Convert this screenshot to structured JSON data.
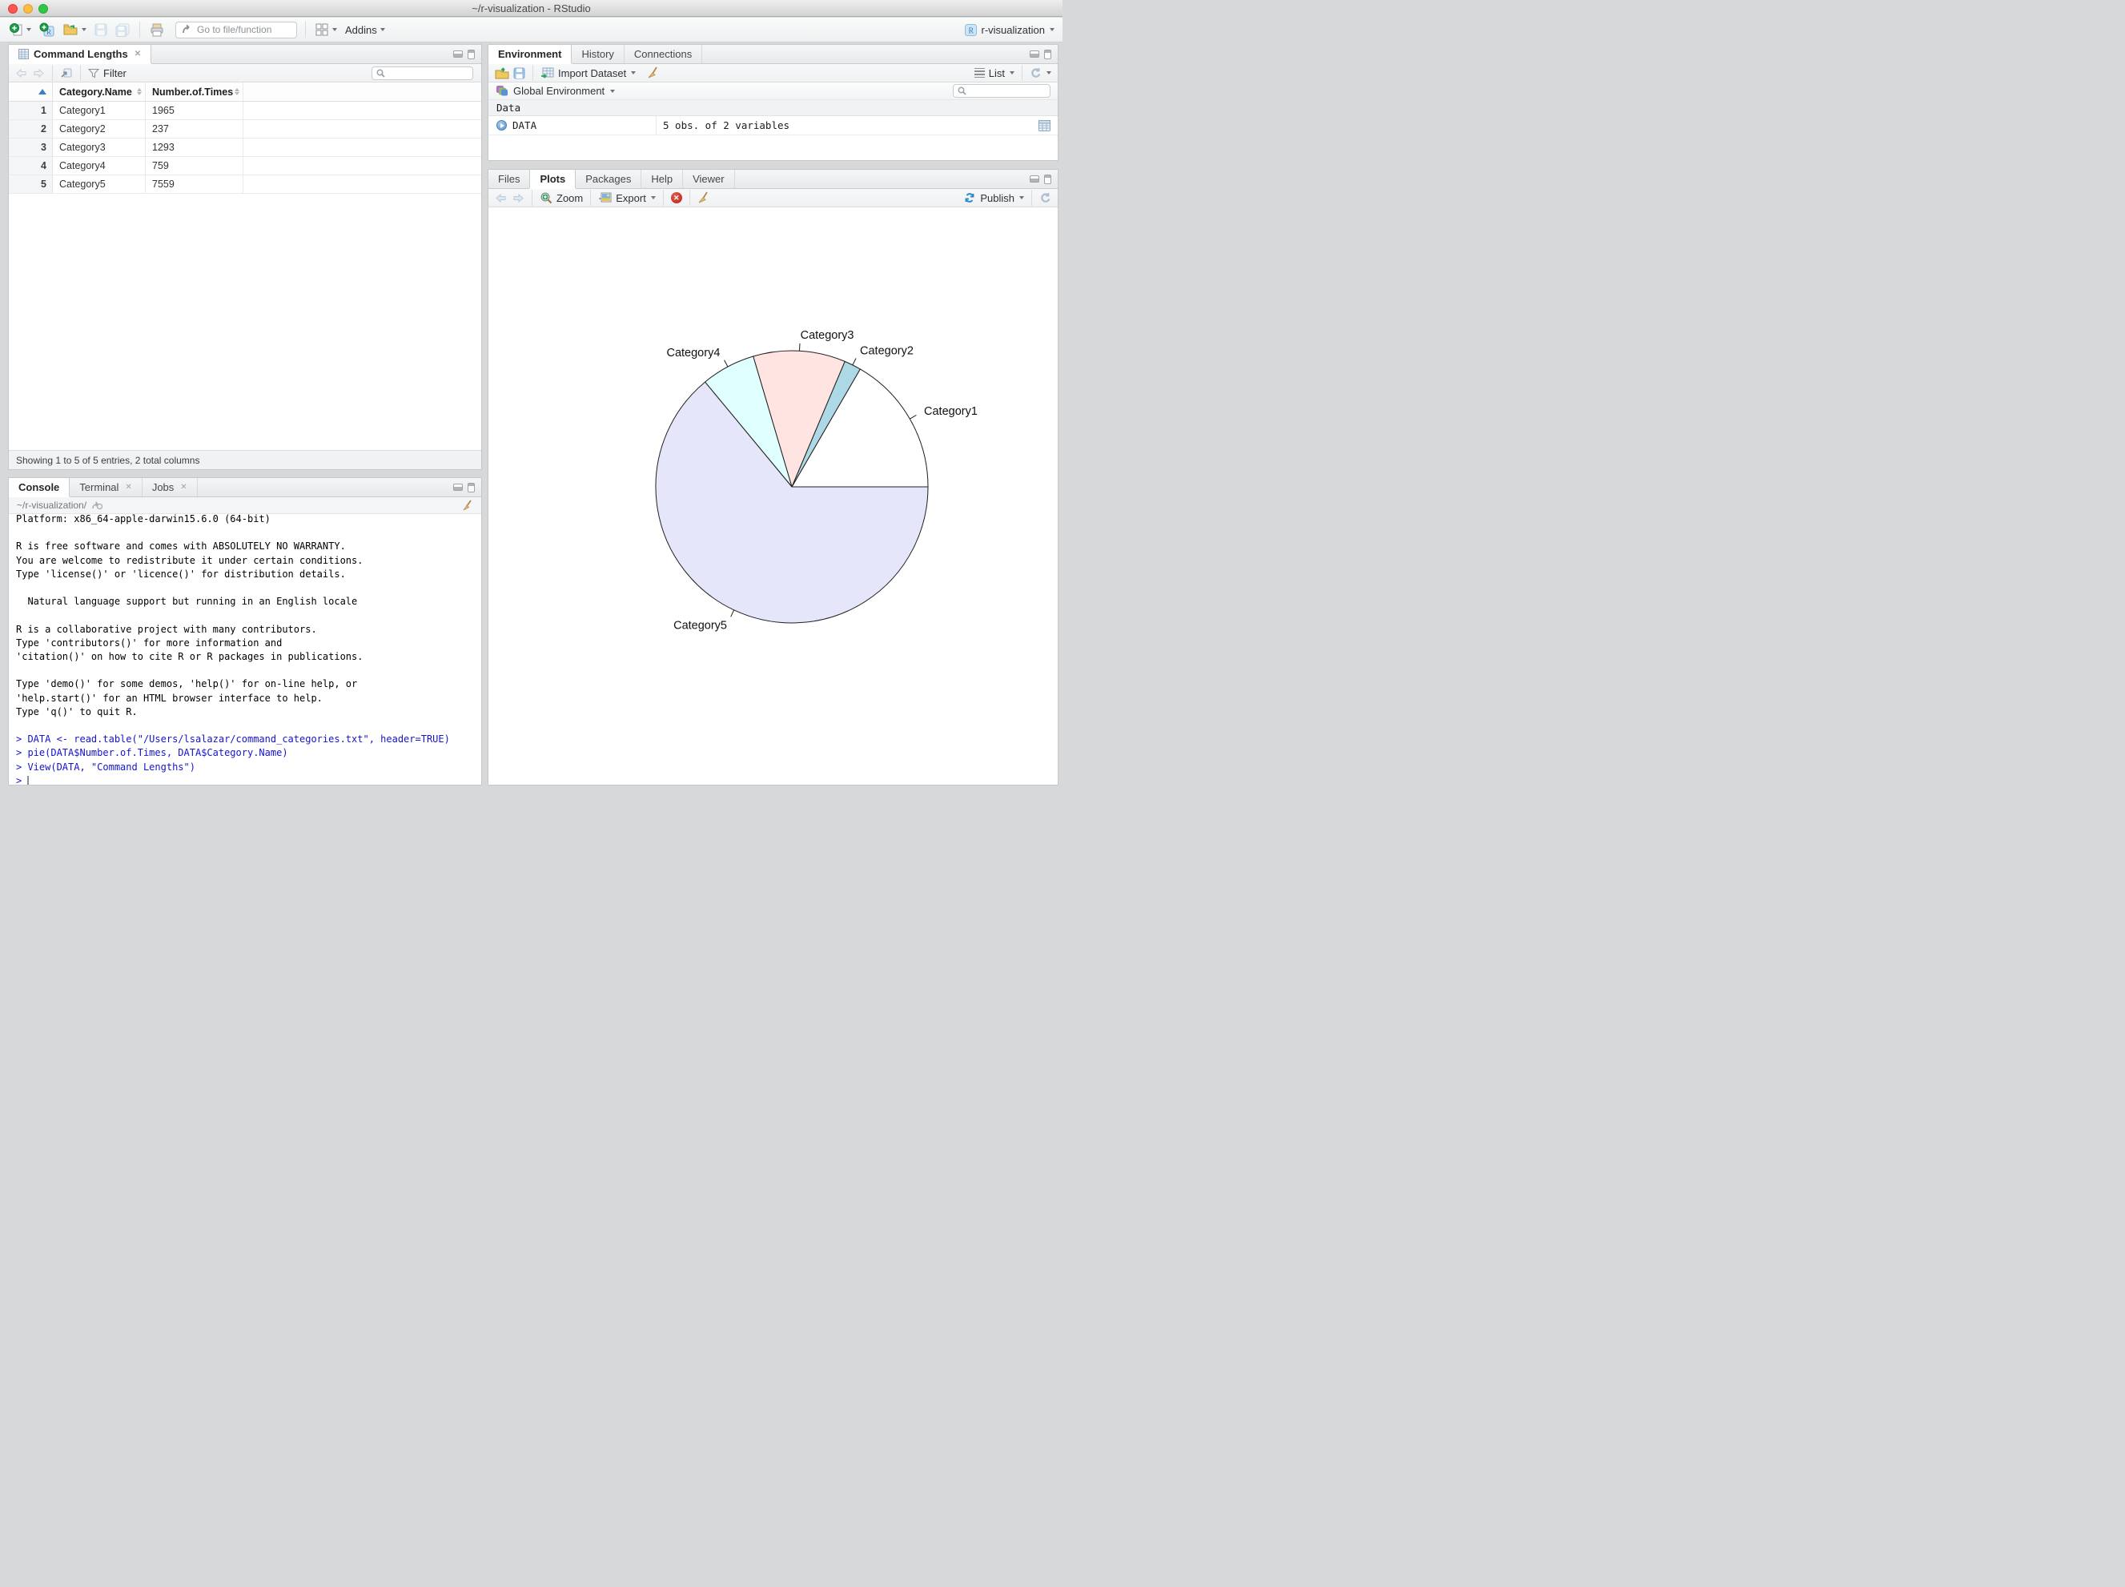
{
  "window": {
    "title": "~/r-visualization - RStudio"
  },
  "main_toolbar": {
    "goto_placeholder": "Go to file/function",
    "addins_label": "Addins",
    "project_name": "r-visualization"
  },
  "viewer": {
    "tab_title": "Command Lengths",
    "filter_label": "Filter",
    "table": {
      "columns": [
        "",
        "Category.Name",
        "Number.of.Times"
      ],
      "rows": [
        [
          "1",
          "Category1",
          "1965"
        ],
        [
          "2",
          "Category2",
          "237"
        ],
        [
          "3",
          "Category3",
          "1293"
        ],
        [
          "4",
          "Category4",
          "759"
        ],
        [
          "5",
          "Category5",
          "7559"
        ]
      ]
    },
    "status": "Showing 1 to 5 of 5 entries, 2 total columns"
  },
  "console": {
    "tabs": [
      {
        "label": "Console",
        "active": true,
        "closable": false
      },
      {
        "label": "Terminal",
        "active": false,
        "closable": true
      },
      {
        "label": "Jobs",
        "active": false,
        "closable": true
      }
    ],
    "path": "~/r-visualization/",
    "lines": [
      {
        "text": "Platform: x86_64-apple-darwin15.6.0 (64-bit)",
        "input": false
      },
      {
        "text": "",
        "input": false
      },
      {
        "text": "R is free software and comes with ABSOLUTELY NO WARRANTY.",
        "input": false
      },
      {
        "text": "You are welcome to redistribute it under certain conditions.",
        "input": false
      },
      {
        "text": "Type 'license()' or 'licence()' for distribution details.",
        "input": false
      },
      {
        "text": "",
        "input": false
      },
      {
        "text": "  Natural language support but running in an English locale",
        "input": false
      },
      {
        "text": "",
        "input": false
      },
      {
        "text": "R is a collaborative project with many contributors.",
        "input": false
      },
      {
        "text": "Type 'contributors()' for more information and",
        "input": false
      },
      {
        "text": "'citation()' on how to cite R or R packages in publications.",
        "input": false
      },
      {
        "text": "",
        "input": false
      },
      {
        "text": "Type 'demo()' for some demos, 'help()' for on-line help, or",
        "input": false
      },
      {
        "text": "'help.start()' for an HTML browser interface to help.",
        "input": false
      },
      {
        "text": "Type 'q()' to quit R.",
        "input": false
      },
      {
        "text": "",
        "input": false
      },
      {
        "text": "> DATA <- read.table(\"/Users/lsalazar/command_categories.txt\", header=TRUE)",
        "input": true
      },
      {
        "text": "> pie(DATA$Number.of.Times, DATA$Category.Name)",
        "input": true
      },
      {
        "text": "> View(DATA, \"Command Lengths\")",
        "input": true
      },
      {
        "text": "> ",
        "input": true,
        "cursor": true
      }
    ]
  },
  "environment": {
    "tabs": [
      {
        "label": "Environment",
        "active": true,
        "closable": false
      },
      {
        "label": "History",
        "active": false,
        "closable": false
      },
      {
        "label": "Connections",
        "active": false,
        "closable": false
      }
    ],
    "toolbar": {
      "import_label": "Import Dataset",
      "list_label": "List"
    },
    "global_label": "Global Environment",
    "section_label": "Data",
    "object": {
      "name": "DATA",
      "value": "5 obs. of 2 variables"
    }
  },
  "plots": {
    "tabs": [
      {
        "label": "Files",
        "active": false,
        "closable": false
      },
      {
        "label": "Plots",
        "active": true,
        "closable": false
      },
      {
        "label": "Packages",
        "active": false,
        "closable": false
      },
      {
        "label": "Help",
        "active": false,
        "closable": false
      },
      {
        "label": "Viewer",
        "active": false,
        "closable": false
      }
    ],
    "toolbar": {
      "zoom_label": "Zoom",
      "export_label": "Export",
      "publish_label": "Publish"
    }
  },
  "chart_data": {
    "type": "pie",
    "categories": [
      "Category1",
      "Category2",
      "Category3",
      "Category4",
      "Category5"
    ],
    "values": [
      1965,
      237,
      1293,
      759,
      7559
    ],
    "colors": [
      "#FFFFFF",
      "#ADD8E6",
      "#FFE4E1",
      "#E0FFFF",
      "#E6E6FA"
    ],
    "start_angle_deg": 0,
    "direction": "counterclockwise",
    "stroke": "#1F1F1F",
    "title": "",
    "legend": "none"
  }
}
